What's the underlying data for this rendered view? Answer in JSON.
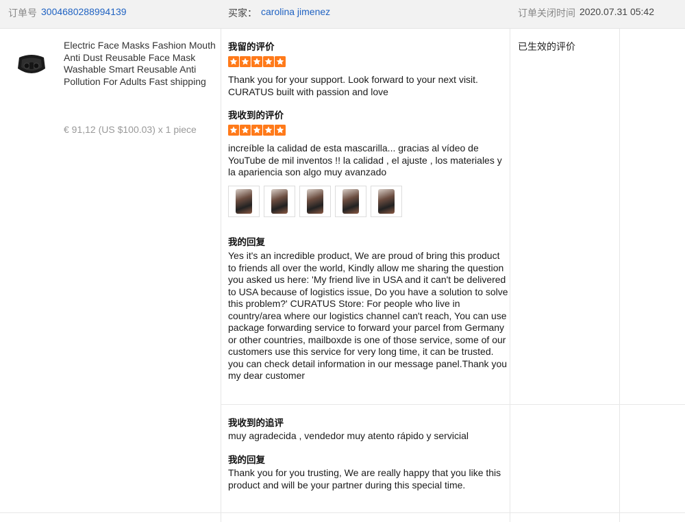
{
  "header": {
    "order_label": "订单号",
    "order_number": "3004680288994139",
    "buyer_label": "买家：",
    "buyer_name": "carolina jimenez",
    "closed_label": "订单关闭时间",
    "closed_time": "2020.07.31 05:42"
  },
  "product": {
    "image_icon": "face-mask-image",
    "title": "Electric Face Masks Fashion Mouth Anti Dust Reusable Face Mask Washable Smart Reusable Anti Pollution For Adults Fast shipping",
    "price": "€ 91,12 (US $100.03) x 1 piece"
  },
  "my_review": {
    "title": "我留的评价",
    "stars": 5,
    "text": "Thank you for your support. Look forward to your next visit. CURATUS built with passion and love"
  },
  "received_review": {
    "title": "我收到的评价",
    "stars": 5,
    "text": "increíble la calidad de esta mascarilla... gracias al vídeo de YouTube de mil inventos !! la calidad , el ajuste , los materiales y la apariencia son algo muy avanzado",
    "photo_count": 5
  },
  "my_reply": {
    "title": "我的回复",
    "text": "Yes it's an incredible product, We are proud of bring this product to friends all over the world, Kindly allow me sharing the question you asked us here: 'My friend live in USA and it can't be delivered to USA because of logistics issue, Do you have a solution to solve this problem?' CURATUS Store: For people who live in country/area where our logistics channel can't reach, You can use package forwarding service to forward your parcel from Germany or other countries, mailboxde is one of those service, some of our customers use this service for very long time, it can be trusted. you can check detail information in our message panel.Thank you my dear customer"
  },
  "followup_review": {
    "title": "我收到的追评",
    "text": "muy agradecida , vendedor muy atento rápido y servicial"
  },
  "followup_reply": {
    "title": "我的回复",
    "text": "Thank you for you trusting, We are really happy that you like this product and will be your partner during this special time."
  },
  "status": {
    "text": "已生效的评价"
  },
  "colors": {
    "link": "#1f62c2",
    "star": "#ff7a1a",
    "header_bg": "#f2f2f2"
  }
}
